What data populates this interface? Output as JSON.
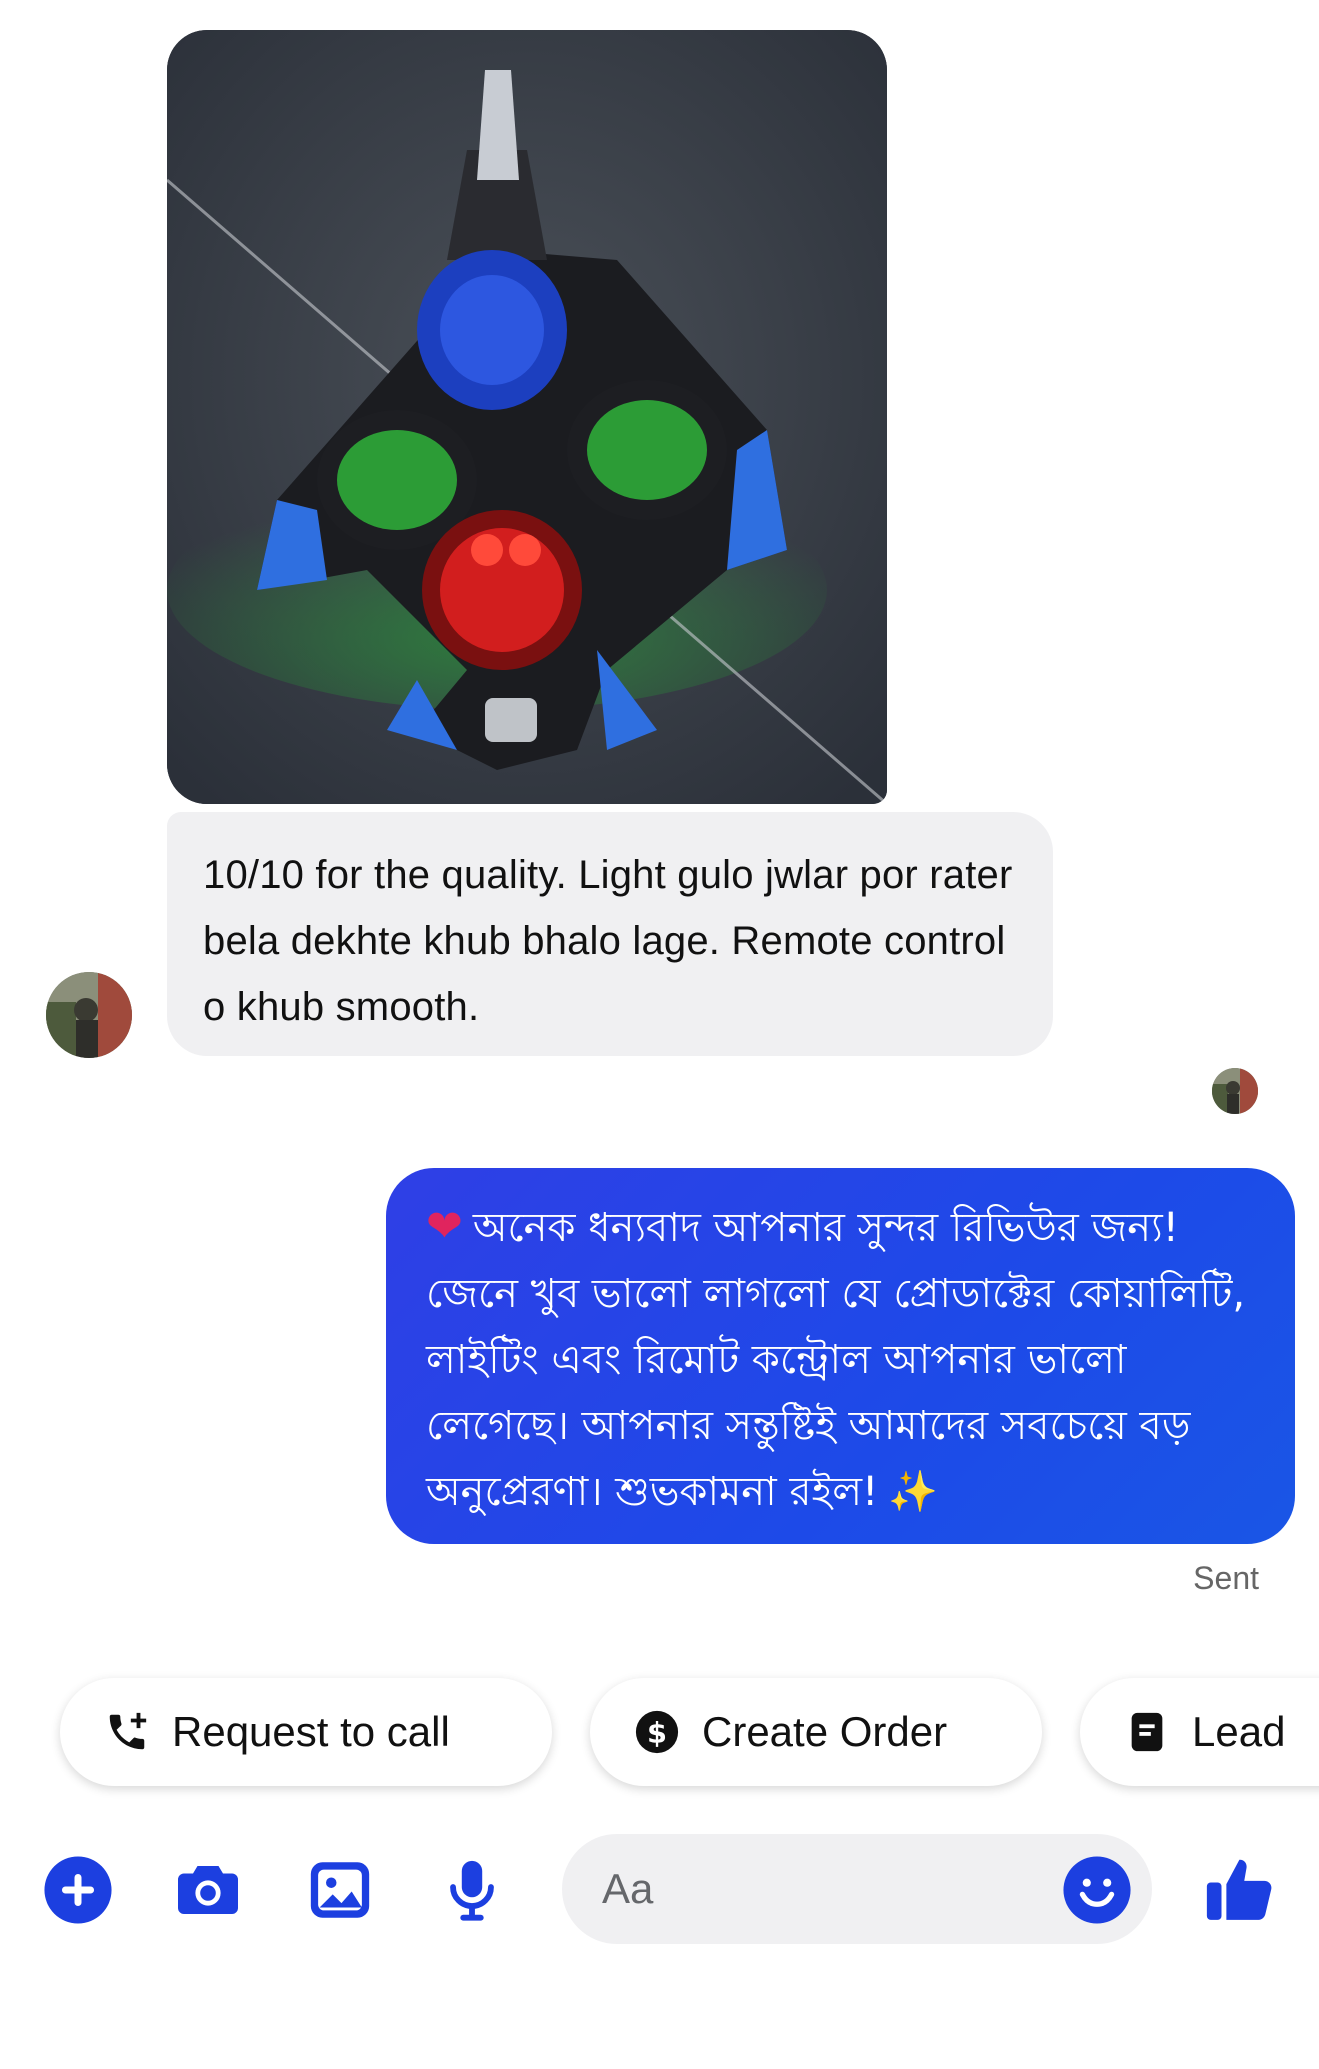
{
  "incoming": {
    "message": "10/10 for the quality. Light gulo jwlar por rater bela dekhte khub bhalo lage. Remote control o khub smooth."
  },
  "outgoing": {
    "heart_icon": "red-heart",
    "message": "অনেক ধন্যবাদ আপনার সুন্দর রিভিউর জন্য! জেনে খুব ভালো লাগলো যে প্রোডাক্টের কোয়ালিটি, লাইটিং এবং রিমোট কন্ট্রোল আপনার ভালো লেগেছে। আপনার সন্তুষ্টিই আমাদের সবচেয়ে বড় অনুপ্রেরণা। শুভকামনা রইল!",
    "sparkle_icon": "sparkles",
    "status": "Sent"
  },
  "quick_actions": [
    {
      "label": "Request to call",
      "icon": "phone-plus-icon"
    },
    {
      "label": "Create Order",
      "icon": "dollar-circle-icon"
    },
    {
      "label": "Lead",
      "icon": "document-icon"
    }
  ],
  "composer": {
    "placeholder": "Aa",
    "tools": [
      "plus-icon",
      "camera-icon",
      "gallery-icon",
      "microphone-icon"
    ],
    "accent": "#1c3fe0"
  }
}
